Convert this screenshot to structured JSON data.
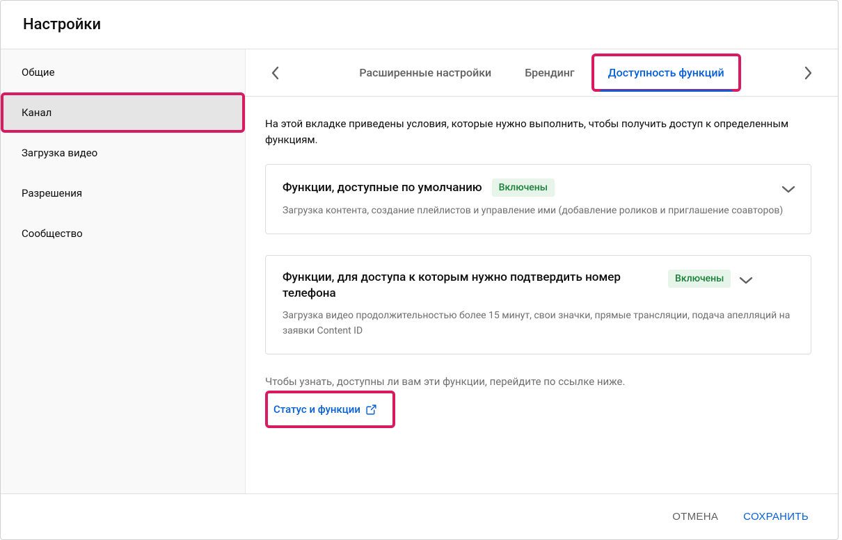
{
  "header": {
    "title": "Настройки"
  },
  "sidebar": {
    "items": [
      {
        "label": "Общие"
      },
      {
        "label": "Канал"
      },
      {
        "label": "Загрузка видео"
      },
      {
        "label": "Разрешения"
      },
      {
        "label": "Сообщество"
      }
    ],
    "activeIndex": 1
  },
  "tabs": {
    "items": [
      {
        "label": "Расширенные настройки"
      },
      {
        "label": "Брендинг"
      },
      {
        "label": "Доступность функций"
      }
    ],
    "activeIndex": 2
  },
  "content": {
    "description": "На этой вкладке приведены условия, которые нужно выполнить, чтобы получить доступ к определенным функциям.",
    "cards": [
      {
        "title": "Функции, доступные по умолчанию",
        "badge": "Включены",
        "sub": "Загрузка контента, создание плейлистов и управление ими (добавление роликов и приглашение соавторов)"
      },
      {
        "title": "Функции, для доступа к которым нужно подтвердить номер телефона",
        "badge": "Включены",
        "sub": "Загрузка видео продолжительностью более 15 минут, свои значки, прямые трансляции, подача апелляций на заявки Content ID"
      }
    ],
    "hint": "Чтобы узнать, доступны ли вам эти функции, перейдите по ссылке ниже.",
    "link_label": "Статус и функции"
  },
  "footer": {
    "cancel": "ОТМЕНА",
    "save": "СОХРАНИТЬ"
  },
  "colors": {
    "accent": "#065fd4",
    "highlight": "#d81b60",
    "badge_bg": "#e6f4ea",
    "badge_fg": "#188038"
  }
}
